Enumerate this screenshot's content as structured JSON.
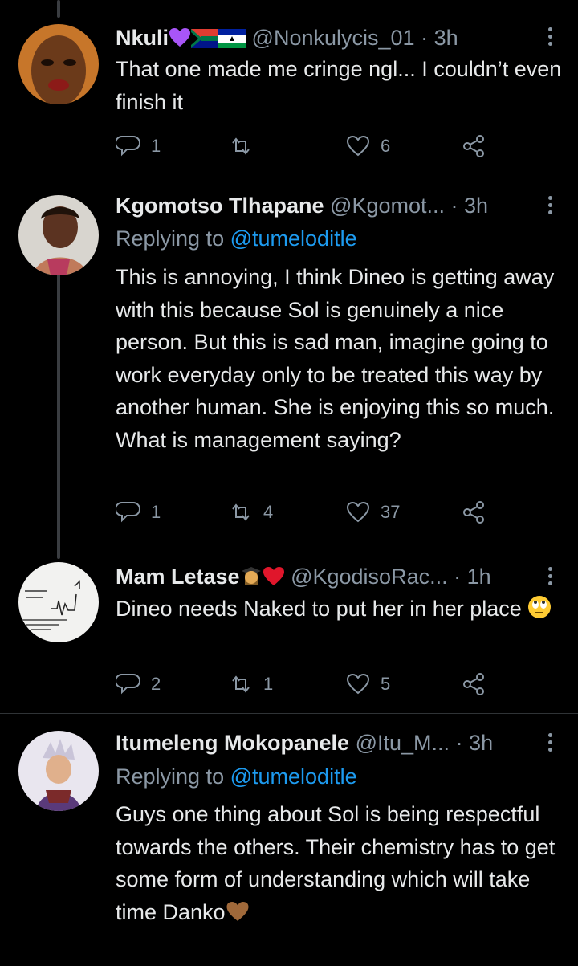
{
  "tweets": [
    {
      "name": "Nkuli",
      "name_emoji": [
        "purple-heart-icon",
        "south-africa-flag-icon",
        "lesotho-flag-icon"
      ],
      "handle": "@Nonkulycis_01",
      "time": "3h",
      "replying_to": "",
      "text": "That one made me cringe ngl... I couldn’t even finish it",
      "reply_count": "1",
      "retweet_count": "",
      "like_count": "6"
    },
    {
      "name": "Kgomotso Tlhapane",
      "handle": "@Kgomot...",
      "time": "3h",
      "replying_label": "Replying to",
      "replying_to": "@tumeloditle",
      "text": "This is annoying, I think Dineo is getting away with this because Sol is genuinely a nice person. But this is sad man, imagine going to work everyday only to be treated this way by another human. She is enjoying this so much. What is management saying?",
      "reply_count": "1",
      "retweet_count": "4",
      "like_count": "37"
    },
    {
      "name": "Mam Letase",
      "name_emoji": [
        "student-emoji-icon",
        "red-heart-icon"
      ],
      "handle": "@KgodisoRac...",
      "time": "1h",
      "replying_to": "",
      "text": "Dineo needs Naked to put her in her place",
      "text_emoji": "rolling-eyes-emoji-icon",
      "reply_count": "2",
      "retweet_count": "1",
      "like_count": "5"
    },
    {
      "name": "Itumeleng Mokopanele",
      "handle": "@Itu_M...",
      "time": "3h",
      "replying_label": "Replying to",
      "replying_to": "@tumeloditle",
      "text": "Guys one thing about Sol is being respectful towards the others. Their chemistry has to get some form of understanding which will take time Danko",
      "text_emoji": "brown-heart-icon"
    }
  ],
  "separator": "·",
  "colors": {
    "background": "#000000",
    "text": "#e7e9ea",
    "muted": "#8b98a5",
    "link": "#1d9bf0",
    "divider": "#2f3336"
  }
}
